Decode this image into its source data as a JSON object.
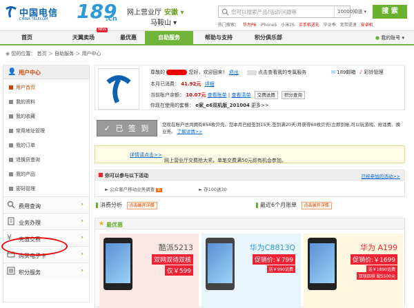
{
  "header": {
    "logo_cn": "中国电信",
    "logo_en": "CHINA TELECOM",
    "brand_num": "189",
    "brand_domain": ".cn",
    "hall": "网上营业厅",
    "province": "安徽 ▾",
    "city": "马鞍山 ▾",
    "search_placeholder": "您可以搜索产品/活动/问题等",
    "search_category": "10000知道 ▾",
    "search_button": "搜 索",
    "hot_label": "热门搜索：",
    "hot_items": [
      "华为P6",
      "iPhone5",
      "小米2S",
      "买手机送礼",
      "毕业季",
      "宽带提速",
      "安卓机"
    ]
  },
  "nav": {
    "items": [
      "首页",
      "天翼卖场",
      "最优惠",
      "自助服务",
      "帮助与支持",
      "积分俱乐部"
    ],
    "new_badge": "NEW",
    "account": "我的账号 ▾"
  },
  "breadcrumb": "您的位置： 首页 ＞ 自助服务 ＞ 用户中心",
  "sidebar": {
    "head": "用户中心",
    "items": [
      "用户首页",
      "我的资料",
      "我的收藏",
      "常用地址管理",
      "我的订单",
      "退换货查询",
      "我的产品",
      "密码管理"
    ],
    "sections": [
      "费用查询",
      "业务办理",
      "充值交费",
      "购买电子卡",
      "积分服务"
    ]
  },
  "welcome": {
    "greet_prefix": "尊敬的",
    "greet_suffix": "您好，欢迎回来！",
    "exit": "退出",
    "service_note": "点击查看我的专属服务",
    "mail": "189邮箱",
    "ring": "彩铃管理",
    "bill_label": "本月已消费：",
    "bill_value": "41.92元",
    "bill_link": "详细",
    "balance_label": "当前账户余额：",
    "balance_value": "10.07元",
    "balance_link1": "查看账单",
    "balance_link2": "查看清单",
    "btn_pay": "交费送费",
    "btn_points": "积分查询",
    "plan_label": "你现在使用的套餐：",
    "plan_value": "e家_e6双机版_201004",
    "plan_more": "更多>>"
  },
  "sign": {
    "button": "✓ 已 签 到",
    "text": "您现在账户总共拥有854枚贝壳。您本月已经签到15天,签到满20天/月获得60枚贝壳(立即到帐,可以玩游戏、抢话费、换业务。",
    "link": "了解详情>>"
  },
  "notice": {
    "text": "网上营业厅交费抢大奖，单笔交费满50元即有机会参加。",
    "link": "详情请点击>>"
  },
  "activity": {
    "title": "你可以参与以下活动",
    "more": "已经参加的活动>>",
    "item1": "公众客户移动业务调查",
    "item1_badge": "新",
    "item2": "存100送30"
  },
  "consume": {
    "title": "消费分析",
    "btn": "点击展开详情"
  },
  "recent": {
    "title": "最近6个月账单",
    "btn": "点击展开详情"
  },
  "promo": {
    "title": "最优惠",
    "cards": [
      {
        "name": "酷派5213",
        "l2": "双网双待双核",
        "l3": "仅￥599"
      },
      {
        "name": "华为C8813Q",
        "l2": "促销价:￥799",
        "l3": "送￥990话费"
      },
      {
        "name": "华为 A199",
        "l2": "促销价:￥1699",
        "l3": "送￥1890话费",
        "l4": "双核四核 配5500元"
      }
    ]
  },
  "colors": {
    "accent": "#70b43a",
    "brand_blue": "#0a62b0",
    "highlight_red": "#e00"
  }
}
